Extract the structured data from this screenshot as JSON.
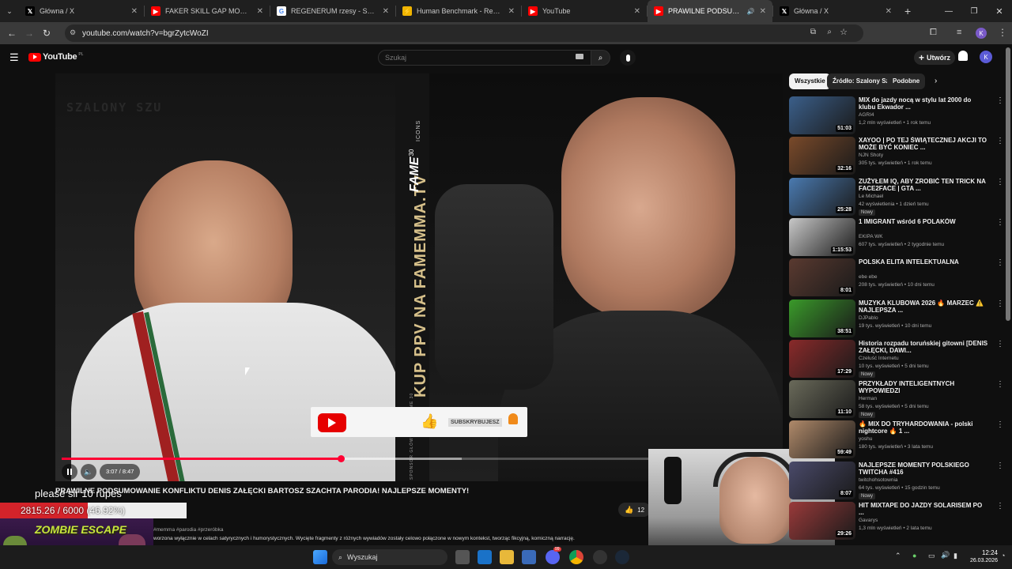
{
  "browser": {
    "tabs": [
      {
        "title": "Główna / X",
        "favicon": "x-logo-icon",
        "active": false
      },
      {
        "title": "FAKER SKILL GAP MOMENT 🫨",
        "favicon": "youtube-icon",
        "active": false
      },
      {
        "title": "REGENERUM rzesy - Szukaj w G",
        "favicon": "google-icon",
        "active": false
      },
      {
        "title": "Human Benchmark - Reaction T",
        "favicon": "humanbenchmark-icon",
        "active": false
      },
      {
        "title": "YouTube",
        "favicon": "youtube-icon",
        "active": false
      },
      {
        "title": "PRAWILNE PODSUMOWAN",
        "favicon": "youtube-icon",
        "active": true
      },
      {
        "title": "Główna / X",
        "favicon": "x-logo-icon",
        "active": false
      }
    ],
    "address": "youtube.com/watch?v=bgrZytcWoZI"
  },
  "youtube": {
    "logo_text": "YouTube",
    "logo_region": "PL",
    "search_placeholder": "Szukaj",
    "create_label": "Utwórz",
    "avatar_letter": "K"
  },
  "video": {
    "overlay_channel": "SZALONY SZU",
    "banner_text": "KUP PPV NA FAMEMMA.TV",
    "fame_text": "FAME",
    "fame_num": "30",
    "icons_text": "ICONS",
    "sponsor_text": "SPONSOR GŁÓWNY GALI FAME 30",
    "time_display": "3:07 / 8:47",
    "progress_fraction": 0.39,
    "buffer_fraction": 0.56,
    "subscribe_label": "SUBSKRYBUJESZ"
  },
  "video_title": "PRAWILNE PODSUMOWANIE KONFLIKTU DENIS ZAŁĘCKI BARTOSZ SZACHTA PARODIA! NAJLEPSZE MOMENTY!",
  "like_count": "12",
  "description_tags": "#memma #parodia #przeróbka",
  "description_text": "worzona wyłącznie w celach satyrycznych i humorystycznych. Wycięte fragmenty z różnych wywiadów zostały celowo połączone w nowym kontekst, tworząc fikcyjną, komiczną narrację.",
  "stream_overlay": {
    "message": "please sir 10 rupes",
    "counter": "2815.26 / 6000 (46.92%)",
    "counter_fraction": 0.4692,
    "game_title": "ZOMBIE ESCAPE"
  },
  "chips": [
    "Wszystkie",
    "Źródło: Szalony Szu",
    "Podobne"
  ],
  "recommendations": [
    {
      "title": "MIX do jazdy nocą w stylu lat 2000 do klubu Ekwador ...",
      "channel": "AGRI4",
      "meta": "1,2 mln wyświetleń • 1 rok temu",
      "duration": "51:03",
      "badge": "",
      "thumb_color": "#3b5f8a"
    },
    {
      "title": "XAYOO | PO TEJ ŚWIĄTECZNEJ AKCJI TO MOŻE BYĆ KONIEC ...",
      "channel": "NJN Shoty",
      "meta": "305 tys. wyświetleń • 1 rok temu",
      "duration": "32:16",
      "badge": "",
      "thumb_color": "#7a4a2a"
    },
    {
      "title": "ZUŻYŁEM IQ, ABY ZROBIĆ TEN TRICK NA FACE2FACE | GTA ...",
      "channel": "Le Michael",
      "meta": "42 wyświetlenia • 1 dzień temu",
      "duration": "25:28",
      "badge": "Nowy",
      "thumb_color": "#4a7ab0"
    },
    {
      "title": "1 IMIGRANT wśród 6 POLAKÓW",
      "channel": "EKIPA WK",
      "meta": "607 tys. wyświetleń • 2 tygodnie temu",
      "duration": "1:15:53",
      "badge": "",
      "thumb_color": "#c8c8c8"
    },
    {
      "title": "POLSKA ELITA INTELEKTUALNA",
      "channel": "ebe ebe",
      "meta": "208 tys. wyświetleń • 10 dni temu",
      "duration": "8:01",
      "badge": "",
      "thumb_color": "#5a3a30"
    },
    {
      "title": "MUZYKA KLUBOWA 2026 🔥 MARZEC ⚠️ NAJLEPSZA ...",
      "channel": "DJPablo",
      "meta": "19 tys. wyświetleń • 10 dni temu",
      "duration": "38:51",
      "badge": "",
      "thumb_color": "#3a9a2a"
    },
    {
      "title": "Historia rozpadu toruńskiej gitowni [DENIS ZAŁĘCKI, DAWI...",
      "channel": "Czeluść Internetu",
      "meta": "10 tys. wyświetleń • 5 dni temu",
      "duration": "17:29",
      "badge": "Nowy",
      "thumb_color": "#8a2a2a"
    },
    {
      "title": "PRZYKŁADY INTELIGENTNYCH WYPOWIEDZI",
      "channel": "Herman",
      "meta": "58 tys. wyświetleń • 5 dni temu",
      "duration": "11:10",
      "badge": "Nowy",
      "thumb_color": "#6a6a5a"
    },
    {
      "title": "🔥 MIX DO TRYHARDOWANIA - polski nightcore 🔥 1 ...",
      "channel": "yoshu",
      "meta": "180 tys. wyświetleń • 3 lata temu",
      "duration": "59:49",
      "badge": "",
      "thumb_color": "#b08a6a"
    },
    {
      "title": "NAJLEPSZE MOMENTY POLSKIEGO TWITCHA #416",
      "channel": "twitchohsotownia",
      "meta": "64 tys. wyświetleń • 15 godzin temu",
      "duration": "8:07",
      "badge": "Nowy",
      "thumb_color": "#4a4a6a"
    },
    {
      "title": "HIT MIXTAPE DO JAZDY SOLARISEM PO ...",
      "channel": "Gavarys",
      "meta": "1,3 mln wyświetleń • 2 lata temu",
      "duration": "29:26",
      "badge": "",
      "thumb_color": "#9a3a3a"
    }
  ],
  "taskbar": {
    "search_label": "Wyszukaj",
    "time": "12:24",
    "date": "26.03.2026",
    "discord_badge": "99"
  }
}
